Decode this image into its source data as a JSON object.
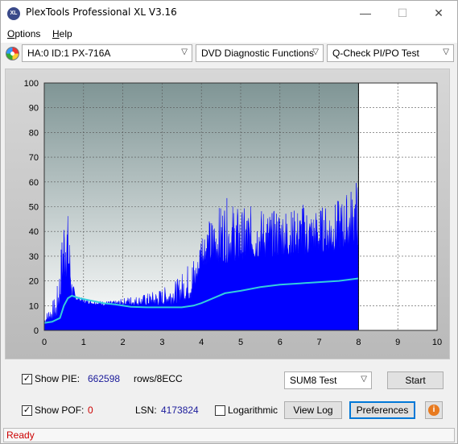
{
  "window": {
    "title": "PlexTools Professional XL V3.16",
    "icon_text": "XL",
    "min_glyph": "—",
    "max_glyph": "☐",
    "close_glyph": "✕"
  },
  "menu": {
    "items": [
      {
        "label": "Options",
        "mnemonic": "O",
        "rest": "ptions"
      },
      {
        "label": "Help",
        "mnemonic": "H",
        "rest": "elp"
      }
    ]
  },
  "toolbar": {
    "drive": "HA:0 ID:1  PX-716A",
    "function": "DVD Diagnostic Functions",
    "test": "Q-Check PI/PO Test",
    "arrow_glyph": "▽"
  },
  "chart_data": {
    "type": "area",
    "x_ticks": [
      "0",
      "1",
      "2",
      "3",
      "4",
      "5",
      "6",
      "7",
      "8",
      "9",
      "10"
    ],
    "y_ticks": [
      "0",
      "10",
      "20",
      "30",
      "40",
      "50",
      "60",
      "70",
      "80",
      "90",
      "100"
    ],
    "xlim": [
      0,
      10
    ],
    "ylim": [
      0,
      100
    ],
    "scan_end_x": 8,
    "grid": true,
    "colors": {
      "pie": "#0000ff",
      "speed": "#33ccdd",
      "bg_top": "#7f9595",
      "bg_bottom": "#ffffff",
      "unscanned": "#ffffff"
    },
    "series": [
      {
        "key": "pie_envelope",
        "points": [
          [
            0.0,
            5
          ],
          [
            0.1,
            9
          ],
          [
            0.2,
            12
          ],
          [
            0.3,
            14
          ],
          [
            0.4,
            28
          ],
          [
            0.45,
            40
          ],
          [
            0.5,
            52
          ],
          [
            0.55,
            61
          ],
          [
            0.6,
            48
          ],
          [
            0.65,
            40
          ],
          [
            0.7,
            22
          ],
          [
            0.8,
            14
          ],
          [
            1.0,
            13
          ],
          [
            1.2,
            12
          ],
          [
            1.4,
            12
          ],
          [
            1.6,
            12
          ],
          [
            1.8,
            12
          ],
          [
            2.0,
            13
          ],
          [
            2.2,
            14
          ],
          [
            2.4,
            14
          ],
          [
            2.6,
            15
          ],
          [
            2.8,
            16
          ],
          [
            3.0,
            17
          ],
          [
            3.2,
            19
          ],
          [
            3.4,
            21
          ],
          [
            3.6,
            26
          ],
          [
            3.8,
            31
          ],
          [
            3.9,
            28
          ],
          [
            4.0,
            43
          ],
          [
            4.2,
            45
          ],
          [
            4.4,
            49
          ],
          [
            4.6,
            54
          ],
          [
            4.8,
            52
          ],
          [
            5.0,
            49
          ],
          [
            5.2,
            51
          ],
          [
            5.4,
            49
          ],
          [
            5.6,
            50
          ],
          [
            5.8,
            48
          ],
          [
            6.0,
            51
          ],
          [
            6.2,
            50
          ],
          [
            6.4,
            49
          ],
          [
            6.6,
            52
          ],
          [
            6.8,
            49
          ],
          [
            7.0,
            50
          ],
          [
            7.2,
            51
          ],
          [
            7.4,
            52
          ],
          [
            7.6,
            54
          ],
          [
            7.8,
            58
          ],
          [
            7.9,
            62
          ],
          [
            8.0,
            61
          ]
        ]
      },
      {
        "key": "pie_base",
        "points": [
          [
            0.0,
            3
          ],
          [
            0.3,
            4
          ],
          [
            0.4,
            10
          ],
          [
            0.5,
            20
          ],
          [
            0.6,
            22
          ],
          [
            0.7,
            13
          ],
          [
            1.0,
            11
          ],
          [
            1.5,
            10
          ],
          [
            2.0,
            10
          ],
          [
            2.5,
            10
          ],
          [
            3.0,
            10
          ],
          [
            3.5,
            11
          ],
          [
            3.8,
            13
          ],
          [
            4.0,
            26
          ],
          [
            4.5,
            27
          ],
          [
            5.0,
            28
          ],
          [
            5.5,
            29
          ],
          [
            6.0,
            30
          ],
          [
            6.5,
            30
          ],
          [
            7.0,
            31
          ],
          [
            7.5,
            32
          ],
          [
            8.0,
            34
          ]
        ]
      },
      {
        "key": "speed",
        "points": [
          [
            0.0,
            3
          ],
          [
            0.2,
            3.5
          ],
          [
            0.4,
            5
          ],
          [
            0.5,
            10
          ],
          [
            0.6,
            13
          ],
          [
            0.7,
            14
          ],
          [
            0.9,
            13
          ],
          [
            1.2,
            12
          ],
          [
            1.5,
            11
          ],
          [
            1.8,
            10.5
          ],
          [
            2.2,
            9.5
          ],
          [
            2.6,
            9.3
          ],
          [
            3.0,
            9.3
          ],
          [
            3.5,
            9.3
          ],
          [
            3.8,
            10
          ],
          [
            4.0,
            11
          ],
          [
            4.3,
            13
          ],
          [
            4.6,
            15
          ],
          [
            5.0,
            16
          ],
          [
            5.5,
            17.5
          ],
          [
            6.0,
            18.5
          ],
          [
            6.5,
            19
          ],
          [
            7.0,
            19.5
          ],
          [
            7.5,
            20
          ],
          [
            8.0,
            21
          ]
        ]
      }
    ]
  },
  "controls": {
    "show_pie_label": "Show PIE:",
    "show_pie_checked": true,
    "pie_value": "662598",
    "rows_label": "rows/8ECC",
    "test_select": "SUM8 Test",
    "start_button": "Start",
    "show_pof_label": "Show POF:",
    "show_pof_checked": true,
    "pof_value": "0",
    "lsn_label": "LSN:",
    "lsn_value": "4173824",
    "logarithmic_label": "Logarithmic",
    "logarithmic_checked": false,
    "view_log_button": "View Log",
    "preferences_button": "Preferences",
    "info_glyph": "i",
    "check_glyph": "✓"
  },
  "status": {
    "text": "Ready"
  }
}
